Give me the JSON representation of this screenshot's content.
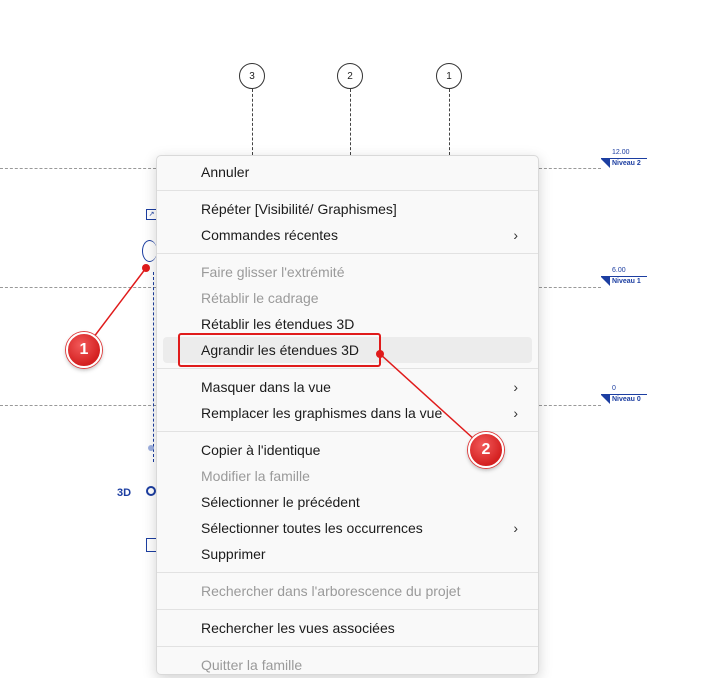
{
  "grid": [
    "3",
    "2",
    "1"
  ],
  "levels": [
    {
      "value": "12.00",
      "name": "Niveau 2"
    },
    {
      "value": "6.00",
      "name": "Niveau 1"
    },
    {
      "value": "0",
      "name": "Niveau 0"
    }
  ],
  "view_label_3d": "3D",
  "menu": {
    "items": [
      {
        "label": "Annuler"
      },
      {
        "label": "Répéter [Visibilité/ Graphismes]"
      },
      {
        "label": "Commandes récentes",
        "arrow": "›"
      },
      {
        "label": "Faire glisser l'extrémité"
      },
      {
        "label": "Rétablir le cadrage"
      },
      {
        "label": "Rétablir les étendues 3D"
      },
      {
        "label": "Agrandir les étendues 3D"
      },
      {
        "label": "Masquer dans la vue",
        "arrow": "›"
      },
      {
        "label": "Remplacer les graphismes dans la vue",
        "arrow": "›"
      },
      {
        "label": "Copier à l'identique"
      },
      {
        "label": "Modifier la famille"
      },
      {
        "label": "Sélectionner le précédent"
      },
      {
        "label": "Sélectionner toutes les occurrences",
        "arrow": "›"
      },
      {
        "label": "Supprimer"
      },
      {
        "label": "Rechercher dans l'arborescence du projet"
      },
      {
        "label": "Rechercher les vues associées"
      },
      {
        "label": "Quitter la famille"
      }
    ]
  },
  "annotations": [
    {
      "number": "1"
    },
    {
      "number": "2"
    }
  ],
  "colors": {
    "accent_red": "#e01b1b",
    "level_blue": "#1c3ea1"
  }
}
